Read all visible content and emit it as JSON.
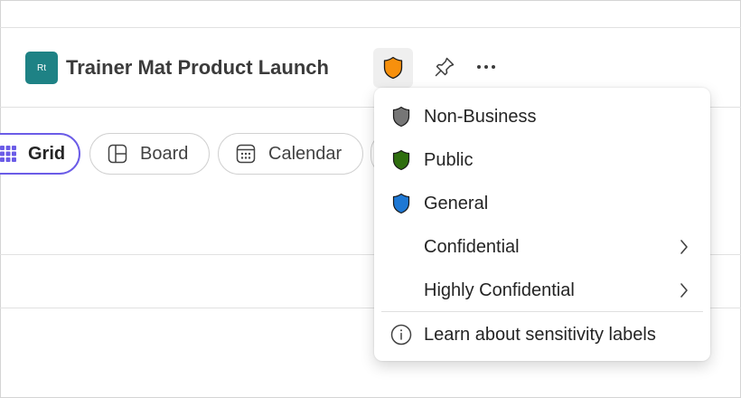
{
  "plan": {
    "avatar_initials": "Rt",
    "title": "Trainer Mat Product Launch"
  },
  "header_actions": {
    "sensitivity_icon": "shield-icon",
    "sensitivity_color": "#f7900d",
    "pin_icon": "pin-icon",
    "more_icon": "more-horizontal-icon"
  },
  "views": [
    {
      "label": "Grid",
      "icon": "grid-icon",
      "selected": true
    },
    {
      "label": "Board",
      "icon": "board-icon",
      "selected": false
    },
    {
      "label": "Calendar",
      "icon": "calendar-icon",
      "selected": false
    }
  ],
  "sensitivity_menu": {
    "items": [
      {
        "label": "Non-Business",
        "icon": "shield-icon",
        "color": "#767676"
      },
      {
        "label": "Public",
        "icon": "shield-icon",
        "color": "#2f6e0f"
      },
      {
        "label": "General",
        "icon": "shield-icon",
        "color": "#1e78d4"
      },
      {
        "label": "Confidential",
        "has_submenu": true
      },
      {
        "label": "Highly Confidential",
        "has_submenu": true
      }
    ],
    "footer": {
      "label": "Learn about sensitivity labels",
      "icon": "info-icon"
    }
  },
  "colors": {
    "accent": "#6b5ce7",
    "avatar_bg": "#1e8285"
  }
}
